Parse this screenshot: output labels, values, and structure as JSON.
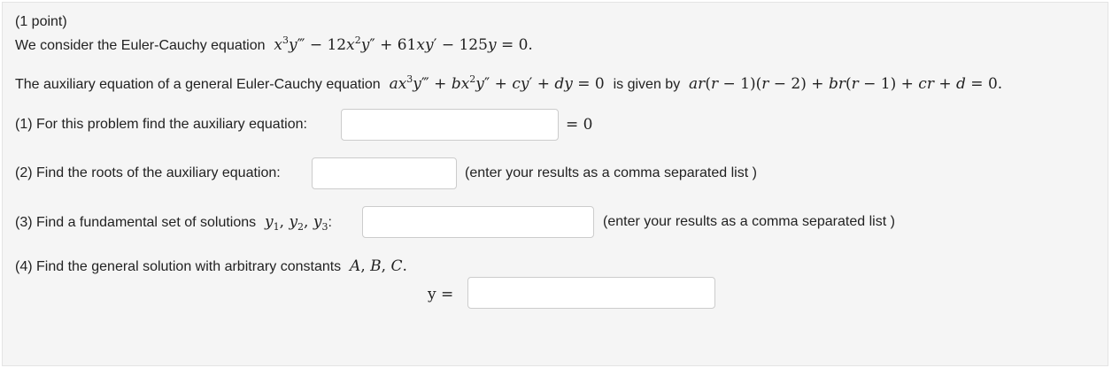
{
  "header": {
    "points": "(1 point)",
    "intro": "We consider the Euler-Cauchy equation"
  },
  "auxiliary_intro": {
    "text1": "The auxiliary equation of a general Euler-Cauchy equation",
    "text2": "is given by"
  },
  "parts": {
    "p1": {
      "label": "(1) For this problem find the auxiliary equation:",
      "suffix": "= 0",
      "value": ""
    },
    "p2": {
      "label": "(2) Find the roots of the auxiliary equation:",
      "note": "(enter your results as a comma separated list )",
      "value": ""
    },
    "p3": {
      "label": "(3) Find a fundamental set of solutions",
      "note": "(enter your results as a comma separated list )",
      "value": ""
    },
    "p4": {
      "label": "(4) Find the general solution with arbitrary constants",
      "y_label": "y =",
      "value": ""
    }
  }
}
